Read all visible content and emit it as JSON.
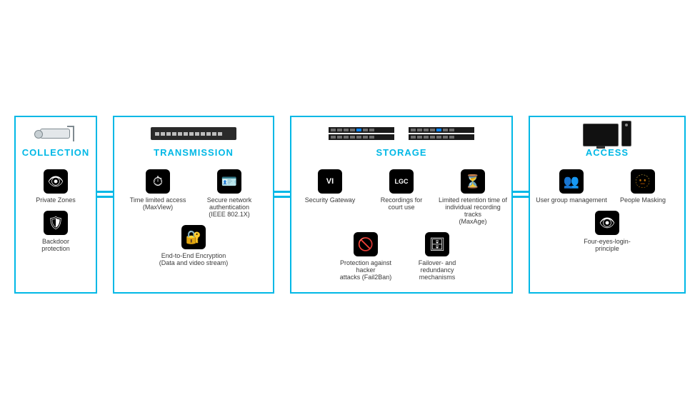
{
  "sections": {
    "collection": {
      "title": "COLLECTION",
      "features": [
        {
          "icon": "👁",
          "label": "Private Zones"
        },
        {
          "icon": "🛡",
          "label": "Backdoor\nprotection"
        }
      ]
    },
    "transmission": {
      "title": "TRANSMISSION",
      "features": [
        {
          "icon": "⏱",
          "label": "Time limited access\n(MaxView)"
        },
        {
          "icon": "🪪",
          "label": "Secure network\nauthentication\n(IEEE 802.1X)"
        },
        {
          "icon": "🔐",
          "label": "End-to-End Encryption\n(Data and video stream)"
        }
      ]
    },
    "storage": {
      "title": "STORAGE",
      "features": [
        {
          "icon": "VI",
          "label": "Security Gateway"
        },
        {
          "icon": "LGC",
          "label": "Recordings for\ncourt use"
        },
        {
          "icon": "⏳",
          "label": "Limited retention time of\nindividual recording tracks\n(MaxAge)"
        },
        {
          "icon": "🚫",
          "label": "Protection against hacker\nattacks (Fail2Ban)"
        },
        {
          "icon": "🗄",
          "label": "Failover- and\nredundancy mechanisms"
        }
      ]
    },
    "access": {
      "title": "ACCESS",
      "features": [
        {
          "icon": "👥",
          "label": "User group management"
        },
        {
          "icon": "🫥",
          "label": "People Masking"
        },
        {
          "icon": "👁",
          "label": "Four-eyes-login-\nprinciple"
        }
      ]
    }
  }
}
